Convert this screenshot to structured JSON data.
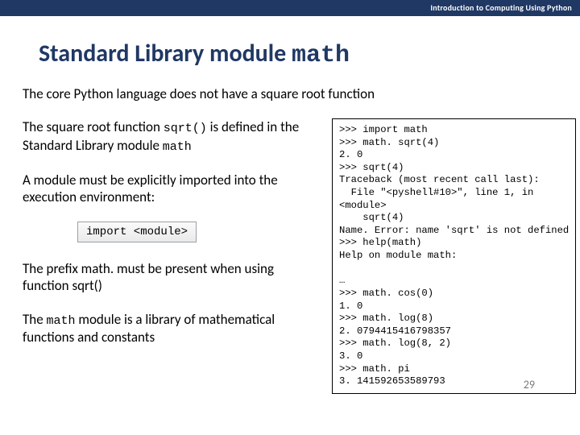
{
  "banner": "Introduction to Computing Using Python",
  "title_a": "Standard Library module ",
  "title_b": "math",
  "line1": "The core Python language does not have a square root function",
  "left": {
    "p1a": "The square root function ",
    "p1code": "sqrt()",
    "p1b": " is defined in the Standard Library module ",
    "p1code2": "math",
    "p2": "A module must be explicitly imported into the execution environment:",
    "importline": "import <module>",
    "p3": "The prefix math. must be present when using function sqrt()",
    "p4a": "The ",
    "p4code": "math",
    "p4b": " module is a library of mathematical functions and constants"
  },
  "code": ">>> import math\n>>> math. sqrt(4)\n2. 0\n>>> sqrt(4)\nTraceback (most recent call last):\n  File \"<pyshell#10>\", line 1, in\n<module>\n    sqrt(4)\nName. Error: name 'sqrt' is not defined\n>>> help(math)\nHelp on module math:\n\n…\n>>> math. cos(0)\n1. 0\n>>> math. log(8)\n2. 0794415416798357\n>>> math. log(8, 2)\n3. 0\n>>> math. pi\n3. 141592653589793",
  "pagenum": "29"
}
